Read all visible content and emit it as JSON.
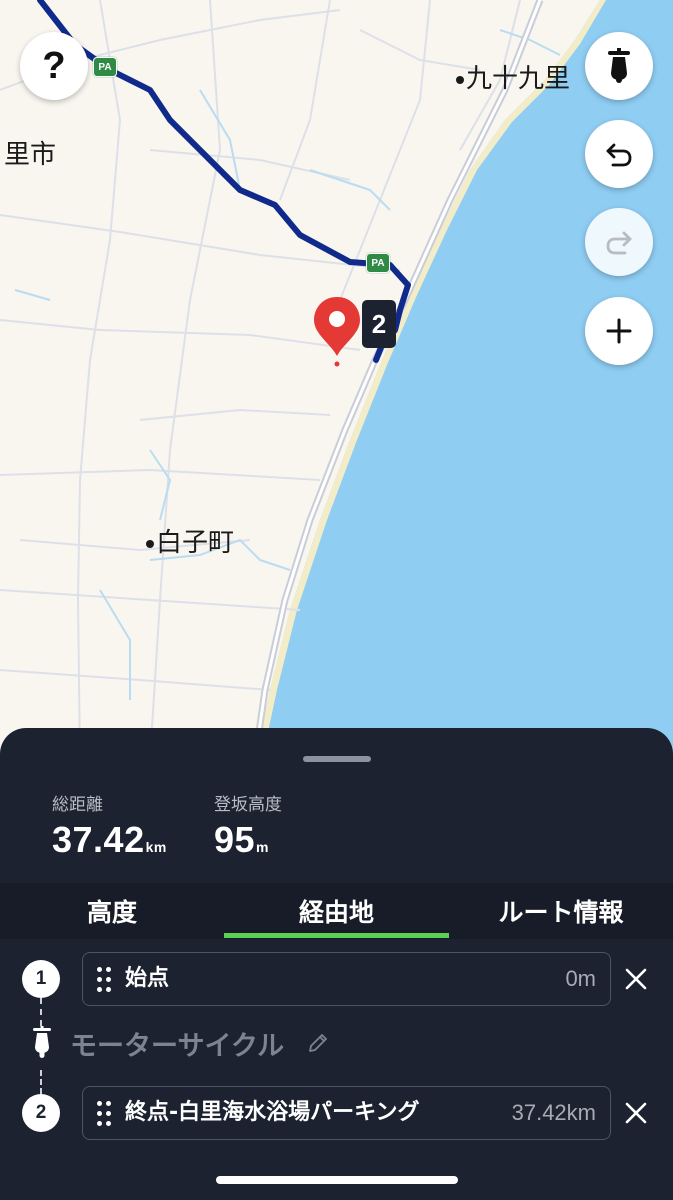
{
  "map": {
    "places": [
      {
        "id": "kujukuri",
        "label": "九十九里"
      },
      {
        "id": "city-partial",
        "label": "里市"
      },
      {
        "id": "shirako",
        "label": "白子町"
      }
    ],
    "pa_label": "PA",
    "waypoint_marker_number": "2",
    "help_button": "?",
    "colors": {
      "land": "#f8f6ef",
      "sea": "#8fcdf2",
      "route": "#102a8c",
      "pin": "#e53935",
      "pa_badge": "#2f8a45"
    },
    "buttons": [
      "motorcycle-icon",
      "undo-icon",
      "redo-icon",
      "plus-icon"
    ]
  },
  "summary": {
    "distance_label": "総距離",
    "distance_value": "37.42",
    "distance_unit": "km",
    "elevation_label": "登坂高度",
    "elevation_value": "95",
    "elevation_unit": "m"
  },
  "tabs": [
    {
      "label": "高度",
      "active": false
    },
    {
      "label": "経由地",
      "active": true
    },
    {
      "label": "ルート情報",
      "active": false
    }
  ],
  "active_tab_color": "#5ccf56",
  "waypoints": [
    {
      "number": "1",
      "name": "始点",
      "distance": "0m"
    },
    {
      "number": "2",
      "name": "終点-白里海水浴場パーキング",
      "distance": "37.42km"
    }
  ],
  "travel_mode": {
    "label": "モーターサイクル",
    "icon": "motorcycle-icon"
  }
}
